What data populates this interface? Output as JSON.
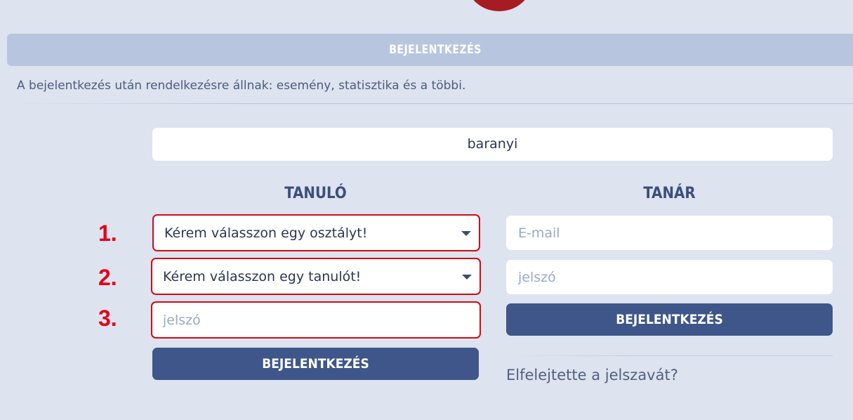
{
  "colors": {
    "background": "#dde3ef",
    "title_bar": "#b8c5df",
    "button": "#3e5689",
    "highlight": "#d10a14",
    "logo": "#a51d22"
  },
  "header": {
    "title": "BEJELENTKEZÉS"
  },
  "info": "A bejelentkezés után rendelkezésre állnak: esemény, statisztika és a többi.",
  "school": {
    "value": "baranyi"
  },
  "student": {
    "heading": "TANULÓ",
    "class_select": {
      "number": "1.",
      "value": "Kérem válasszon egy osztályt!"
    },
    "student_select": {
      "number": "2.",
      "value": "Kérem válasszon egy tanulót!"
    },
    "password": {
      "number": "3.",
      "placeholder": "jelszó"
    },
    "login_label": "BEJELENTKEZÉS"
  },
  "teacher": {
    "heading": "TANÁR",
    "email": {
      "placeholder": "E-mail"
    },
    "password": {
      "placeholder": "jelszó"
    },
    "login_label": "BEJELENTKEZÉS",
    "forgot_label": "Elfelejtette a jelszavát?"
  }
}
